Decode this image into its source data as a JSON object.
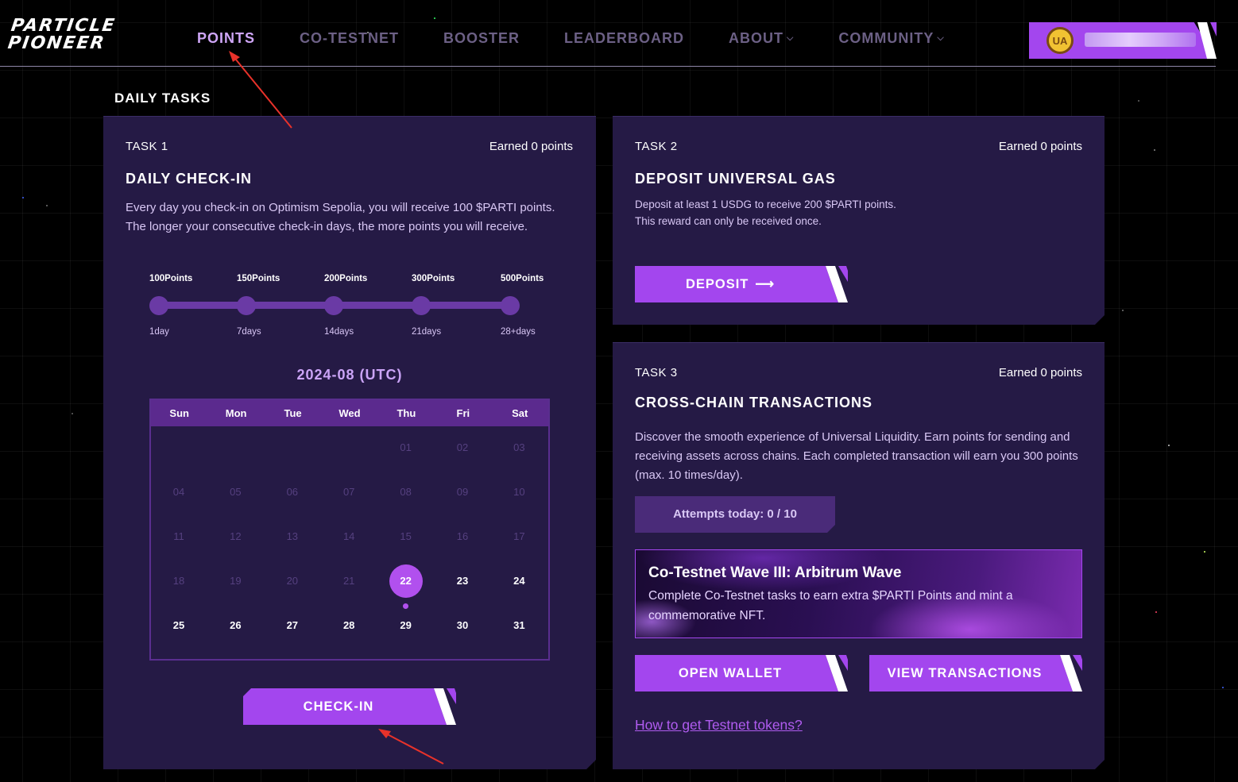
{
  "brand": {
    "line1": "PARTICLE",
    "line2": "PIONEER"
  },
  "nav": {
    "points": "POINTS",
    "co_testnet": "CO-TESTNET",
    "booster": "BOOSTER",
    "leaderboard": "LEADERBOARD",
    "about": "ABOUT",
    "community": "COMMUNITY"
  },
  "user": {
    "badge": "UA",
    "name": ""
  },
  "section_title": "DAILY TASKS",
  "task1": {
    "label": "TASK 1",
    "earned": "Earned 0 points",
    "title": "DAILY CHECK-IN",
    "description": "Every day you check-in on Optimism Sepolia, you will receive 100 $PARTI points. The longer your consecutive check-in days, the more points you will receive.",
    "milestones": [
      {
        "points": "100Points",
        "days": "1day"
      },
      {
        "points": "150Points",
        "days": "7days"
      },
      {
        "points": "200Points",
        "days": "14days"
      },
      {
        "points": "300Points",
        "days": "21days"
      },
      {
        "points": "500Points",
        "days": "28+days"
      }
    ],
    "calendar": {
      "title": "2024-08 (UTC)",
      "weekdays": [
        "Sun",
        "Mon",
        "Tue",
        "Wed",
        "Thu",
        "Fri",
        "Sat"
      ],
      "first_weekday": 4,
      "days_in_month": 31,
      "today": 22
    },
    "button": "CHECK-IN"
  },
  "task2": {
    "label": "TASK 2",
    "earned": "Earned 0 points",
    "title": "DEPOSIT UNIVERSAL GAS",
    "description_line1": "Deposit at least 1 USDG to receive 200 $PARTI points.",
    "description_line2": "This reward can only be received once.",
    "button": "DEPOSIT"
  },
  "task3": {
    "label": "TASK 3",
    "earned": "Earned 0 points",
    "title": "CROSS-CHAIN TRANSACTIONS",
    "description": "Discover the smooth experience of Universal Liquidity. Earn points for sending and receiving assets across chains. Each completed transaction will earn you 300 points (max. 10 times/day).",
    "attempts": "Attempts today: 0 / 10",
    "banner_title": "Co-Testnet Wave III: Arbitrum Wave",
    "banner_text": "Complete Co-Testnet tasks to earn extra $PARTI Points and mint a commemorative NFT.",
    "open_wallet": "OPEN WALLET",
    "view_transactions": "VIEW TRANSACTIONS",
    "help_link": "How to get Testnet tokens?"
  },
  "colors": {
    "accent": "#a346ee",
    "card": "#251a45",
    "annotation_arrow": "#e8322a"
  }
}
